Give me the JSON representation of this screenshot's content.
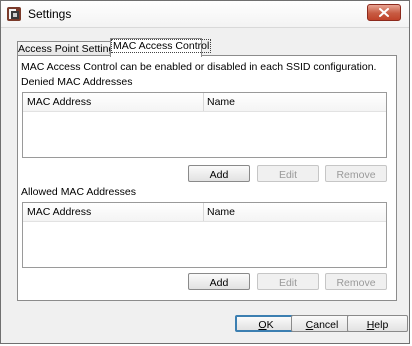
{
  "window": {
    "title": "Settings",
    "icons": {
      "app": "settings-app-icon",
      "close": "close-icon"
    }
  },
  "tabs": [
    {
      "label": "Access Point Settings",
      "selected": false
    },
    {
      "label": "MAC Access Control",
      "selected": true
    }
  ],
  "panel": {
    "info": "MAC Access Control can be enabled or disabled in each SSID configuration.",
    "denied": {
      "label": "Denied MAC Addresses",
      "columns": [
        "MAC Address",
        "Name"
      ],
      "rows": [],
      "buttons": {
        "add": "Add",
        "edit": "Edit",
        "remove": "Remove"
      }
    },
    "allowed": {
      "label": "Allowed MAC Addresses",
      "columns": [
        "MAC Address",
        "Name"
      ],
      "rows": [],
      "buttons": {
        "add": "Add",
        "edit": "Edit",
        "remove": "Remove"
      }
    }
  },
  "footer": {
    "ok": {
      "mnemonic": "O",
      "rest": "K"
    },
    "cancel": {
      "mnemonic": "C",
      "rest": "ancel"
    },
    "help": {
      "mnemonic": "H",
      "rest": "elp"
    }
  },
  "colors": {
    "close_button": "#c75b42",
    "default_button_border": "#3c7fb1"
  }
}
